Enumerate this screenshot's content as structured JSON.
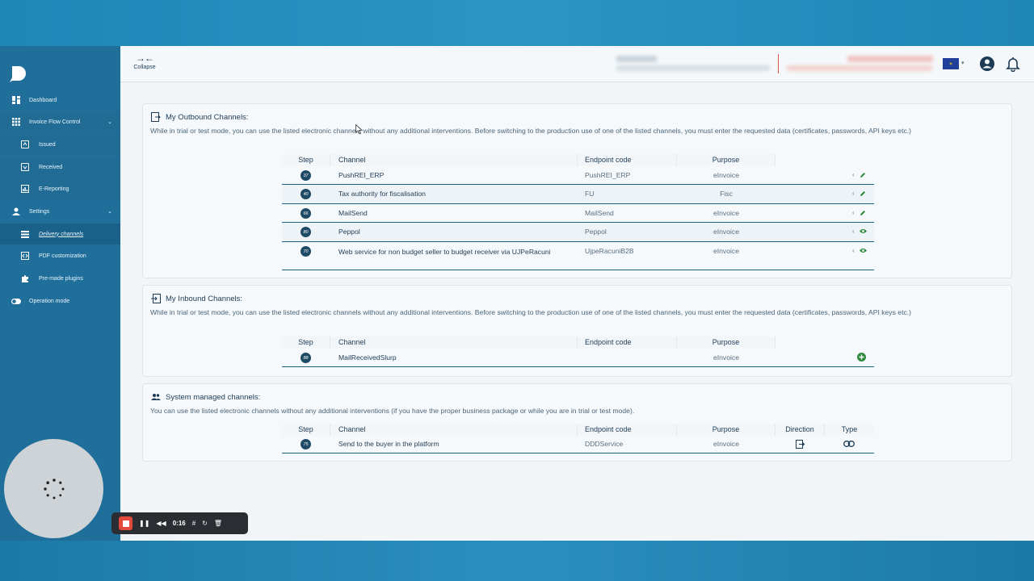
{
  "header": {
    "collapse_label": "Collapse"
  },
  "sidebar": {
    "items": [
      {
        "label": "Dashboard",
        "icon": "dashboard-icon"
      },
      {
        "label": "Invoice Flow Control",
        "icon": "grid-icon"
      },
      {
        "label": "Issued",
        "icon": "issued-icon"
      },
      {
        "label": "Received",
        "icon": "received-icon"
      },
      {
        "label": "E-Reporting",
        "icon": "chart-icon"
      },
      {
        "label": "Settings",
        "icon": "user-icon"
      },
      {
        "label": "Delivery channels",
        "icon": "list-icon"
      },
      {
        "label": "PDF customization",
        "icon": "code-icon"
      },
      {
        "label": "Pre-made plugins",
        "icon": "puzzle-icon"
      },
      {
        "label": "Operation mode",
        "icon": "toggle-icon"
      }
    ]
  },
  "outbound": {
    "title": "My Outbound Channels:",
    "description": "While in trial or test mode, you can use the listed electronic channels without any additional interventions. Before switching to the production use of one of the listed channels, you must enter the requested data (certificates, passwords, API keys etc.)",
    "headers": {
      "step": "Step",
      "channel": "Channel",
      "endpoint": "Endpoint code",
      "purpose": "Purpose"
    },
    "rows": [
      {
        "step": "37",
        "channel": "PushREI_ERP",
        "endpoint": "PushREI_ERP",
        "purpose": "eInvoice",
        "action": "edit"
      },
      {
        "step": "40",
        "channel": "Tax authority for fiscalisation",
        "endpoint": "FU",
        "purpose": "Fisc",
        "action": "edit"
      },
      {
        "step": "66",
        "channel": "MailSend",
        "endpoint": "MailSend",
        "purpose": "eInvoice",
        "action": "edit"
      },
      {
        "step": "80",
        "channel": "Peppol",
        "endpoint": "Peppol",
        "purpose": "eInvoice",
        "action": "view"
      },
      {
        "step": "70",
        "channel": "Web service for non budget seller to budget receiver via UJPeRacuni",
        "endpoint": "UjpeRacuniB2B",
        "purpose": "eInvoice",
        "action": "view"
      }
    ]
  },
  "inbound": {
    "title": "My Inbound Channels:",
    "description": "While in trial or test mode, you can use the listed electronic channels without any additional interventions. Before switching to the production use of one of the listed channels, you must enter the requested data (certificates, passwords, API keys etc.)",
    "headers": {
      "step": "Step",
      "channel": "Channel",
      "endpoint": "Endpoint code",
      "purpose": "Purpose"
    },
    "rows": [
      {
        "step": "88",
        "channel": "MailReceivedSlurp",
        "endpoint": "",
        "purpose": "eInvoice",
        "action": "add"
      }
    ]
  },
  "system": {
    "title": "System managed channels:",
    "description": "You can use the listed electronic channels without any additional interventions (if you have the proper business package or while you are in trial or test mode).",
    "headers": {
      "step": "Step",
      "channel": "Channel",
      "endpoint": "Endpoint code",
      "purpose": "Purpose",
      "direction": "Direction",
      "type": "Type"
    },
    "rows": [
      {
        "step": "75",
        "channel": "Send to the buyer in the platform",
        "endpoint": "DDDService",
        "purpose": "eInvoice",
        "direction_icon": "outbound-icon",
        "type_icon": "link-icon"
      }
    ]
  },
  "recorder": {
    "time": "0:16"
  },
  "colors": {
    "accent": "#1f6f9a",
    "stop": "#e24a3b",
    "green": "#2e8b3e"
  }
}
